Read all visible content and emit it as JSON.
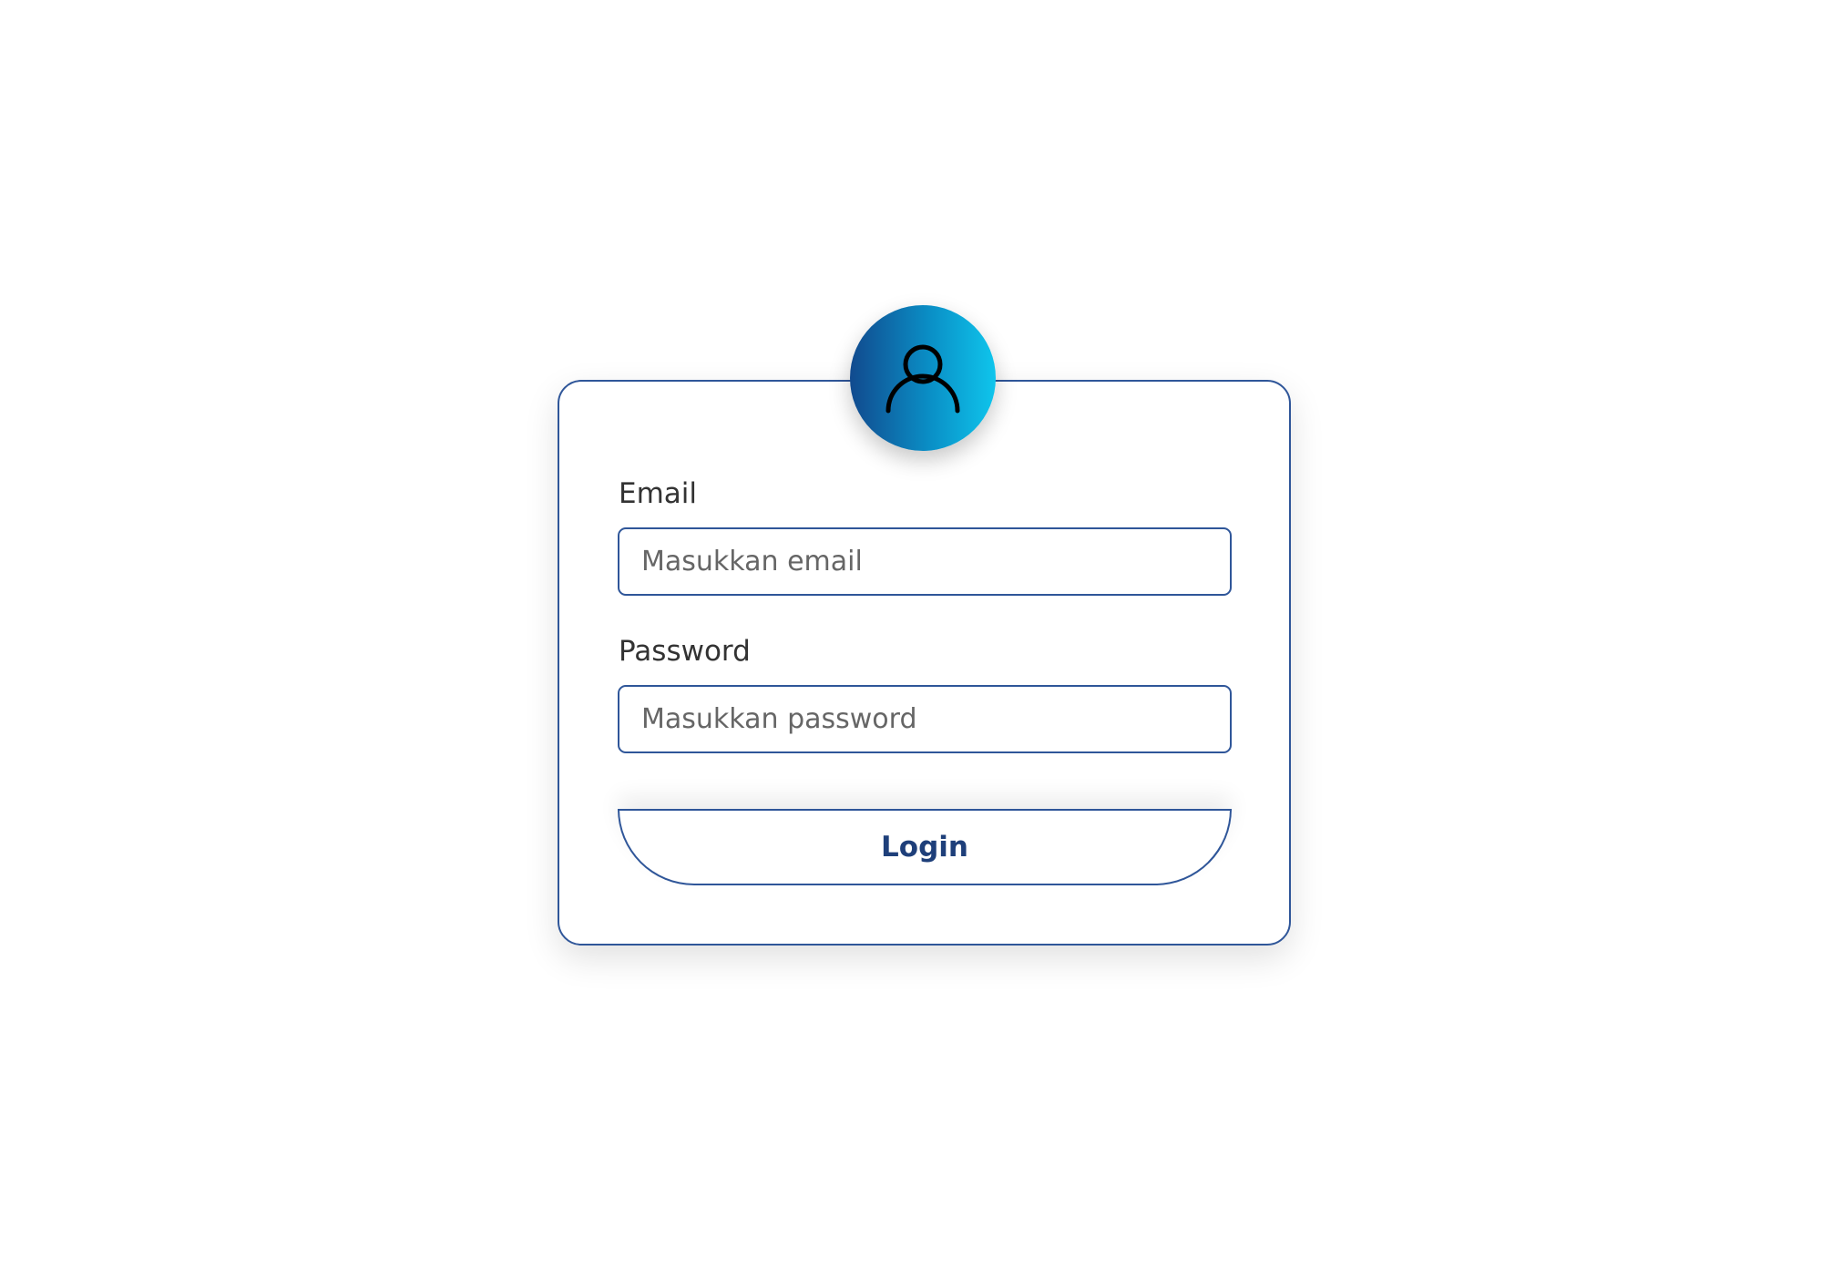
{
  "form": {
    "email_label": "Email",
    "email_placeholder": "Masukkan email",
    "password_label": "Password",
    "password_placeholder": "Masukkan password",
    "login_label": "Login"
  },
  "icons": {
    "avatar": "user-icon"
  },
  "colors": {
    "border": "#2f5699",
    "button_text": "#1e3f7a",
    "avatar_gradient_start": "#114a8e",
    "avatar_gradient_end": "#0fc5ec"
  }
}
